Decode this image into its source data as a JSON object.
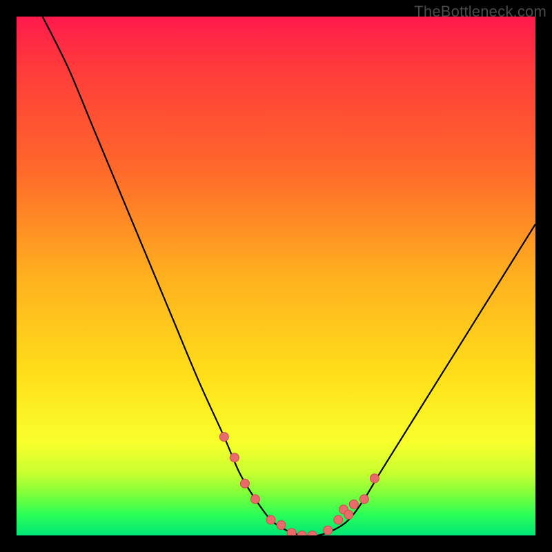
{
  "watermark": "TheBottleneck.com",
  "colors": {
    "background": "#000000",
    "curve": "#000000",
    "marker_fill": "#e86a6a",
    "marker_stroke": "#c94f4f"
  },
  "chart_data": {
    "type": "line",
    "title": "",
    "xlabel": "",
    "ylabel": "",
    "xlim": [
      0,
      100
    ],
    "ylim": [
      0,
      100
    ],
    "grid": false,
    "series": [
      {
        "name": "bottleneck-curve",
        "x": [
          5,
          10,
          15,
          20,
          25,
          30,
          35,
          40,
          43,
          46,
          49,
          52,
          55,
          58,
          61,
          64,
          67,
          70,
          75,
          80,
          85,
          90,
          95,
          100
        ],
        "y": [
          100,
          90,
          78,
          66,
          54,
          42,
          30,
          19,
          12,
          7,
          3,
          1,
          0,
          0,
          1,
          3,
          7,
          12,
          20,
          28,
          36,
          44,
          52,
          60
        ]
      }
    ],
    "markers": {
      "name": "highlight-dots",
      "x": [
        40,
        42,
        44,
        46,
        49,
        51,
        53,
        55,
        57,
        60,
        62,
        63,
        64,
        65,
        67,
        69
      ],
      "y": [
        19,
        15,
        10,
        7,
        3,
        2,
        0.5,
        0,
        0,
        1,
        3,
        5,
        4,
        6,
        7,
        11
      ]
    }
  }
}
